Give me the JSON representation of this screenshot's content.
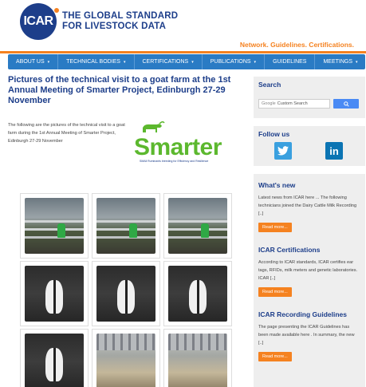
{
  "header": {
    "logo_text": "ICAR",
    "tagline_line1": "THE GLOBAL STANDARD",
    "tagline_line2": "FOR LIVESTOCK DATA",
    "slogan": "Network. Guidelines. Certifications."
  },
  "nav": {
    "items": [
      {
        "label": "ABOUT US",
        "caret": "▾"
      },
      {
        "label": "TECHNICAL BODIES",
        "caret": "▾"
      },
      {
        "label": "CERTIFICATIONS",
        "caret": "▾"
      },
      {
        "label": "PUBLICATIONS",
        "caret": "▾"
      },
      {
        "label": "GUIDELINES",
        "caret": ""
      },
      {
        "label": "MEETINGS",
        "caret": "▾"
      }
    ]
  },
  "article": {
    "title": "Pictures of the technical visit to a goat farm at the 1st Annual Meeting of Smarter Project, Edinburgh 27-29 November",
    "intro": "The following are the pictures  of the technical visit to a goat farm during the 1st Annual Meeting of Smarter Project, Edinburgh 27-29 November",
    "logo": {
      "word": "Smarter",
      "subtitle": "SMAll Ruminants breeding for Efficiency and Resilience"
    },
    "gallery": [
      {
        "kind": "barn"
      },
      {
        "kind": "barn"
      },
      {
        "kind": "barn"
      },
      {
        "kind": "goat"
      },
      {
        "kind": "goat"
      },
      {
        "kind": "goat"
      },
      {
        "kind": "goat"
      },
      {
        "kind": "shed"
      },
      {
        "kind": "shed"
      }
    ]
  },
  "sidebar": {
    "search": {
      "title": "Search",
      "google_label": "Google",
      "placeholder": "Custom Search",
      "button_icon": "search-icon"
    },
    "follow": {
      "title": "Follow us",
      "twitter_icon": "twitter-icon",
      "linkedin_icon": "linkedin-icon",
      "linkedin_text": "in"
    },
    "news": [
      {
        "title": "What's new",
        "text": "Latest news from ICAR here ... The following technicians joined the Dairy Cattle Milk Recording [..]",
        "button": "Read more..."
      },
      {
        "title": "ICAR Certifications",
        "text": "According to ICAR standards, ICAR certifies ear tags, RFIDs, milk meters and genetic laboratories. ICAR [..]",
        "button": "Read more..."
      },
      {
        "title": "ICAR Recording Guidelines",
        "text": "The page presenting the ICAR Guidelines has been made available here . In summary, the new [..]",
        "button": "Read more..."
      }
    ]
  },
  "colors": {
    "brand_blue": "#1d3e8a",
    "nav_blue": "#2a7bc4",
    "accent_orange": "#f58220",
    "smarter_green": "#5cb82e"
  }
}
